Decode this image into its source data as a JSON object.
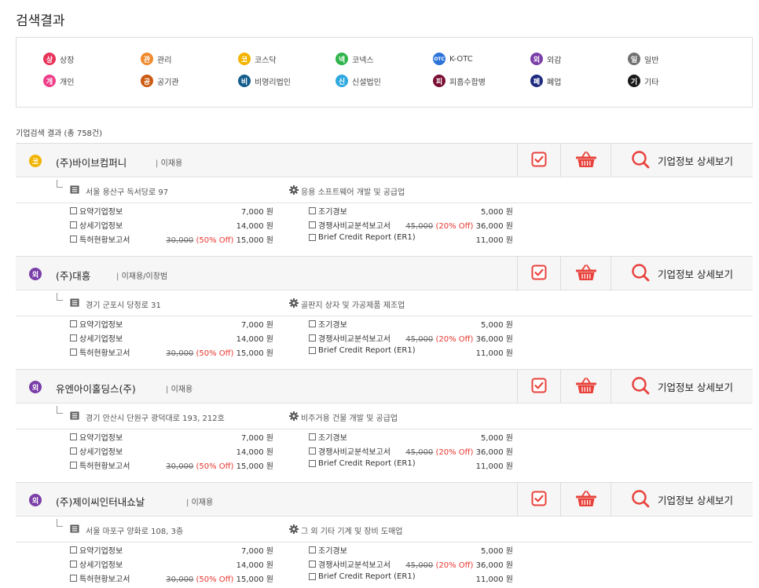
{
  "page_title": "검색결과",
  "legend": [
    {
      "char": "상",
      "label": "상장",
      "color": "#e8335a"
    },
    {
      "char": "관",
      "label": "관리",
      "color": "#f08a2e"
    },
    {
      "char": "코",
      "label": "코스닥",
      "color": "#f2b400"
    },
    {
      "char": "넥",
      "label": "코넥스",
      "color": "#2fb34a"
    },
    {
      "char": "OTC",
      "label": "K-OTC",
      "color": "#2b73d9"
    },
    {
      "char": "외",
      "label": "외감",
      "color": "#7b3fa8"
    },
    {
      "char": "일",
      "label": "일반",
      "color": "#707070"
    },
    {
      "char": "개",
      "label": "개인",
      "color": "#ee3f8a"
    },
    {
      "char": "공",
      "label": "공기관",
      "color": "#cc5a10"
    },
    {
      "char": "비",
      "label": "비영리법인",
      "color": "#145d8c"
    },
    {
      "char": "신",
      "label": "신설법인",
      "color": "#2ea8e0"
    },
    {
      "char": "피",
      "label": "피흡수합병",
      "color": "#7a1035"
    },
    {
      "char": "폐",
      "label": "폐업",
      "color": "#1f2b80"
    },
    {
      "char": "기",
      "label": "기타",
      "color": "#1a1a1a"
    }
  ],
  "result_count": "기업검색 결과 (총 758건)",
  "detail_label": "기업정보 상세보기",
  "companies": [
    {
      "badge": "코",
      "badge_color": "#f2b400",
      "name": "(주)바이브컴퍼니",
      "ceo": "이재용",
      "address": "서울 용산구 독서당로 97",
      "industry": "응용 소프트웨어 개발 및 공급업"
    },
    {
      "badge": "외",
      "badge_color": "#7b3fa8",
      "name": "(주)대흥",
      "ceo": "이재용/이창범",
      "address": "경기 군포시 당정로 31",
      "industry": "골판지 상자 및 가공제품 제조업"
    },
    {
      "badge": "외",
      "badge_color": "#7b3fa8",
      "name": "유엔아이홀딩스(주)",
      "ceo": "이재용",
      "address": "경기 안산시 단원구 광덕대로 193, 212호",
      "industry": "비주거용 건물 개발 및 공급업"
    },
    {
      "badge": "외",
      "badge_color": "#7b3fa8",
      "name": "(주)제이씨인터내쇼날",
      "ceo": "이재용",
      "address": "서울 마포구 양화로 108, 3층",
      "industry": "그 외 기타 기계 및 장비 도매업"
    }
  ],
  "products": {
    "summary": {
      "label": "요약기업정보",
      "price": "7,000 원"
    },
    "detail": {
      "label": "상세기업정보",
      "price": "14,000 원"
    },
    "patent": {
      "label": "특허현황보고서",
      "orig": "30,000",
      "discount": "(50% Off)",
      "price": "15,000 원"
    },
    "early": {
      "label": "조기경보",
      "price": "5,000 원"
    },
    "compare": {
      "label": "경쟁사비교분석보고서",
      "orig": "45,000",
      "discount": "(20% Off)",
      "price": "36,000 원"
    },
    "brief": {
      "label": "Brief Credit Report (ER1)",
      "price": "11,000 원"
    }
  }
}
